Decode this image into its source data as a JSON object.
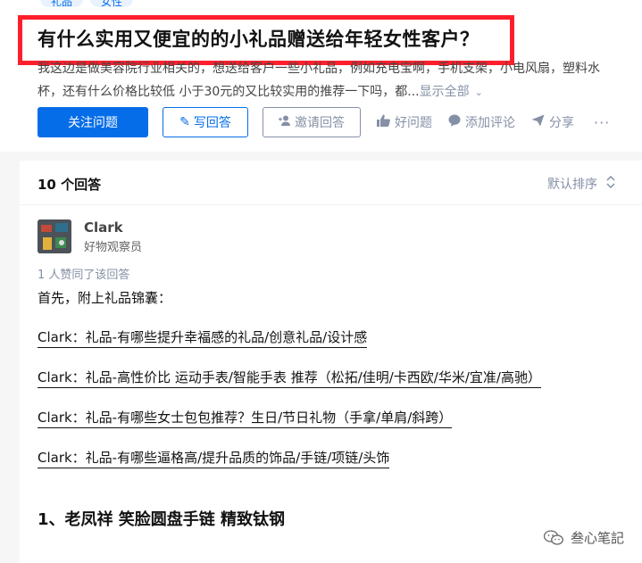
{
  "question": {
    "tags": [
      "礼品",
      "女性"
    ],
    "title": "有什么实用又便宜的的小礼品赠送给年轻女性客户？",
    "detail_line1": "我这边是做美容院行业相关的，想送给客户一些小礼品，例如充电宝啊，手机支架，小电风扇，塑料水",
    "detail_line2": "杯，还有什么价格比较低 小于30元的又比较实用的推荐一下吗，都...",
    "show_all": "显示全部"
  },
  "actions": {
    "follow": "关注问题",
    "write": "写回答",
    "invite": "邀请回答",
    "good": "好问题",
    "comment": "添加评论",
    "share": "分享",
    "more": "···"
  },
  "answers": {
    "count_label": "10 个回答",
    "sort_label": "默认排序"
  },
  "answer": {
    "author_name": "Clark",
    "author_bio": "好物观察员",
    "upvote_note": "1 人赞同了该回答",
    "intro": "首先，附上礼品锦囊：",
    "links": [
      "Clark：礼品-有哪些提升幸福感的礼品/创意礼品/设计感",
      "Clark：礼品-高性价比 运动手表/智能手表 推荐（松拓/佳明/卡西欧/华米/宜准/高驰）",
      "Clark：礼品-有哪些女士包包推荐？生日/节日礼物（手拿/单肩/斜跨）",
      "Clark：礼品-有哪些逼格高/提升品质的饰品/手链/项链/头饰"
    ],
    "section_title": "1、老凤祥 笑脸圆盘手链 精致钛钢"
  },
  "watermark": "叁心笔記",
  "colors": {
    "brand_blue": "#056de8",
    "highlight_red": "#ff1f2c",
    "muted": "#8590a6"
  }
}
